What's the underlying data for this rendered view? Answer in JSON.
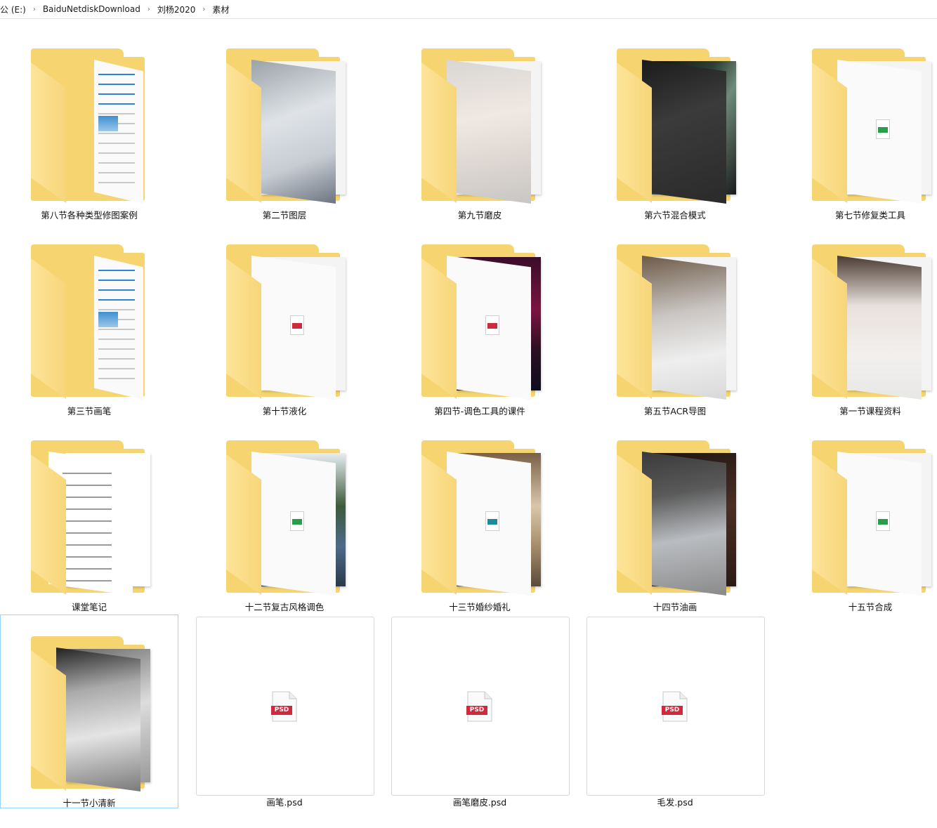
{
  "breadcrumb": [
    "公 (E:)",
    "BaiduNetdiskDownload",
    "刘杨2020",
    "素材"
  ],
  "items": [
    {
      "name": "第八节各种类型修图案例",
      "kind": "folder",
      "thumb": "doc-lines"
    },
    {
      "name": "第二节图层",
      "kind": "folder",
      "thumb": "photo-white-dress"
    },
    {
      "name": "第九节磨皮",
      "kind": "folder",
      "thumb": "photo-portrait"
    },
    {
      "name": "第六节混合模式",
      "kind": "folder",
      "thumb": "photo-dancer"
    },
    {
      "name": "第七节修复类工具",
      "kind": "folder",
      "thumb": "file-green"
    },
    {
      "name": "第三节画笔",
      "kind": "folder",
      "thumb": "doc-lines"
    },
    {
      "name": "第十节液化",
      "kind": "folder",
      "thumb": "file-red"
    },
    {
      "name": "第四节-调色工具的课件",
      "kind": "folder",
      "thumb": "file-red-neon"
    },
    {
      "name": "第五节ACR导图",
      "kind": "folder",
      "thumb": "photo-wedding"
    },
    {
      "name": "第一节课程资料",
      "kind": "folder",
      "thumb": "photo-girl"
    },
    {
      "name": "课堂笔记",
      "kind": "folder",
      "thumb": "doc-notes"
    },
    {
      "name": "十二节复古风格调色",
      "kind": "folder",
      "thumb": "file-green-lake"
    },
    {
      "name": "十三节婚纱婚礼",
      "kind": "folder",
      "thumb": "file-teal-lights"
    },
    {
      "name": "十四节油画",
      "kind": "folder",
      "thumb": "photo-boy"
    },
    {
      "name": "十五节合成",
      "kind": "folder",
      "thumb": "file-green"
    },
    {
      "name": "十一节小清新",
      "kind": "folder",
      "thumb": "photo-bw"
    },
    {
      "name": "画笔.psd",
      "kind": "psd"
    },
    {
      "name": "画笔磨皮.psd",
      "kind": "psd"
    },
    {
      "name": "毛发.psd",
      "kind": "psd"
    }
  ],
  "psd_badge": "PSD",
  "colors": {
    "folder_back": "#f2c85c",
    "folder_front": "#f7d679",
    "selection_border": "#99d1ff",
    "psd_red": "#d0283c"
  }
}
